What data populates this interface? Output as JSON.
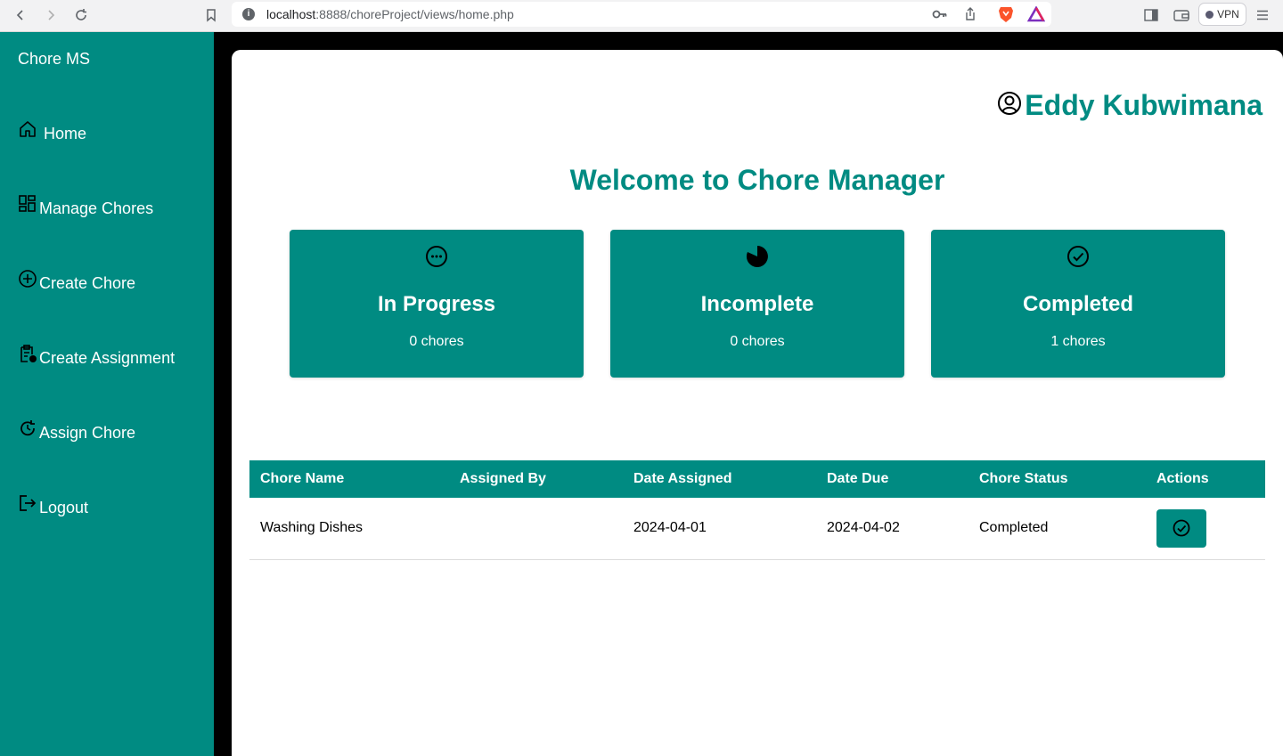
{
  "browser": {
    "url_host": "localhost",
    "url_path": ":8888/choreProject/views/home.php",
    "vpn_label": "VPN"
  },
  "sidebar": {
    "brand": "Chore MS",
    "items": [
      {
        "label": "Home",
        "icon": "home-icon"
      },
      {
        "label": "Manage Chores",
        "icon": "dashboard-icon"
      },
      {
        "label": "Create Chore",
        "icon": "plus-circle-icon"
      },
      {
        "label": "Create Assignment",
        "icon": "clipboard-icon"
      },
      {
        "label": "Assign Chore",
        "icon": "refresh-icon"
      },
      {
        "label": "Logout",
        "icon": "logout-icon"
      }
    ]
  },
  "header": {
    "user_name": "Eddy Kubwimana",
    "title": "Welcome to Chore Manager"
  },
  "cards": [
    {
      "title": "In Progress",
      "count": "0 chores",
      "icon": "dots-circle-icon"
    },
    {
      "title": "Incomplete",
      "count": "0 chores",
      "icon": "pie-icon"
    },
    {
      "title": "Completed",
      "count": "1 chores",
      "icon": "check-circle-icon"
    }
  ],
  "table": {
    "headers": [
      "Chore Name",
      "Assigned By",
      "Date Assigned",
      "Date Due",
      "Chore Status",
      "Actions"
    ],
    "rows": [
      {
        "name": "Washing Dishes",
        "assigned_by": "",
        "date_assigned": "2024-04-01",
        "date_due": "2024-04-02",
        "status": "Completed"
      }
    ]
  },
  "colors": {
    "accent": "#008b82"
  }
}
